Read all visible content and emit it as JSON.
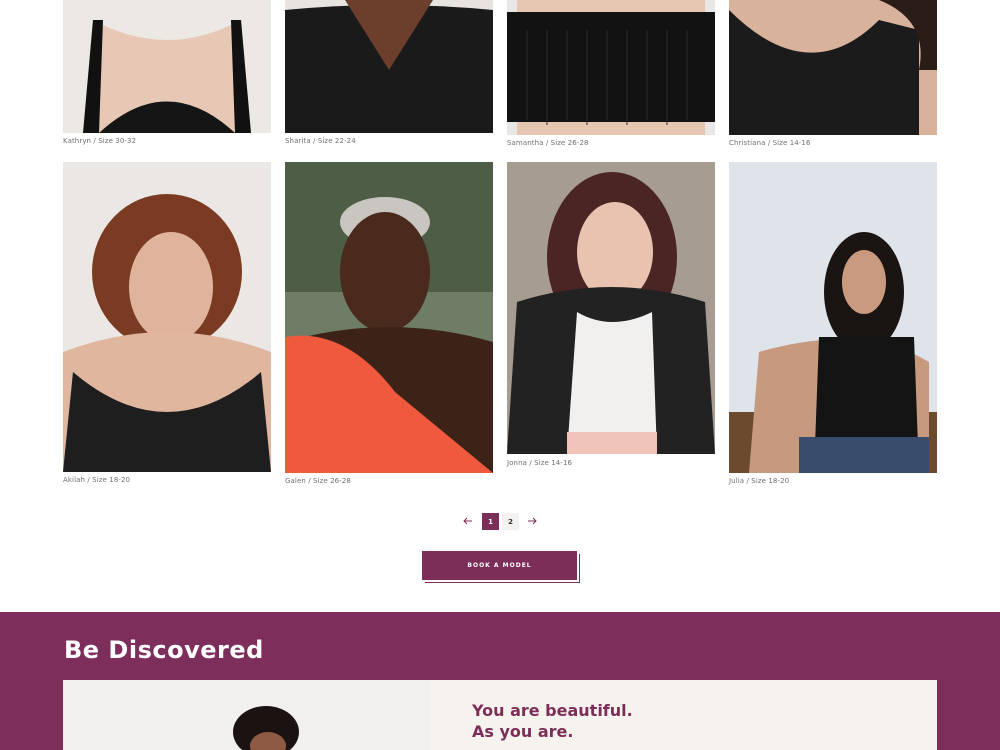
{
  "gallery": {
    "row1": [
      {
        "caption": "Kathryn / Size 30-32"
      },
      {
        "caption": "Sharita / Size 22-24"
      },
      {
        "caption": "Samantha / Size 26-28"
      },
      {
        "caption": "Christiana / Size 14-16"
      }
    ],
    "row2": [
      {
        "caption": "Akilah / Size 18-20"
      },
      {
        "caption": "Galen / Size 26-28"
      },
      {
        "caption": "Jonna / Size 14-16"
      },
      {
        "caption": "Julia / Size 18-20"
      }
    ]
  },
  "pagination": {
    "prev_icon": "arrow-left-icon",
    "next_icon": "arrow-right-icon",
    "pages": [
      "1",
      "2"
    ],
    "current": "1"
  },
  "cta": {
    "label": "BOOK A MODEL"
  },
  "discover": {
    "title": "Be Discovered",
    "tagline_line1": "You are beautiful.",
    "tagline_line2": "As you are."
  },
  "colors": {
    "brand": "#7d2e58",
    "panel": "#f6f3ef"
  }
}
